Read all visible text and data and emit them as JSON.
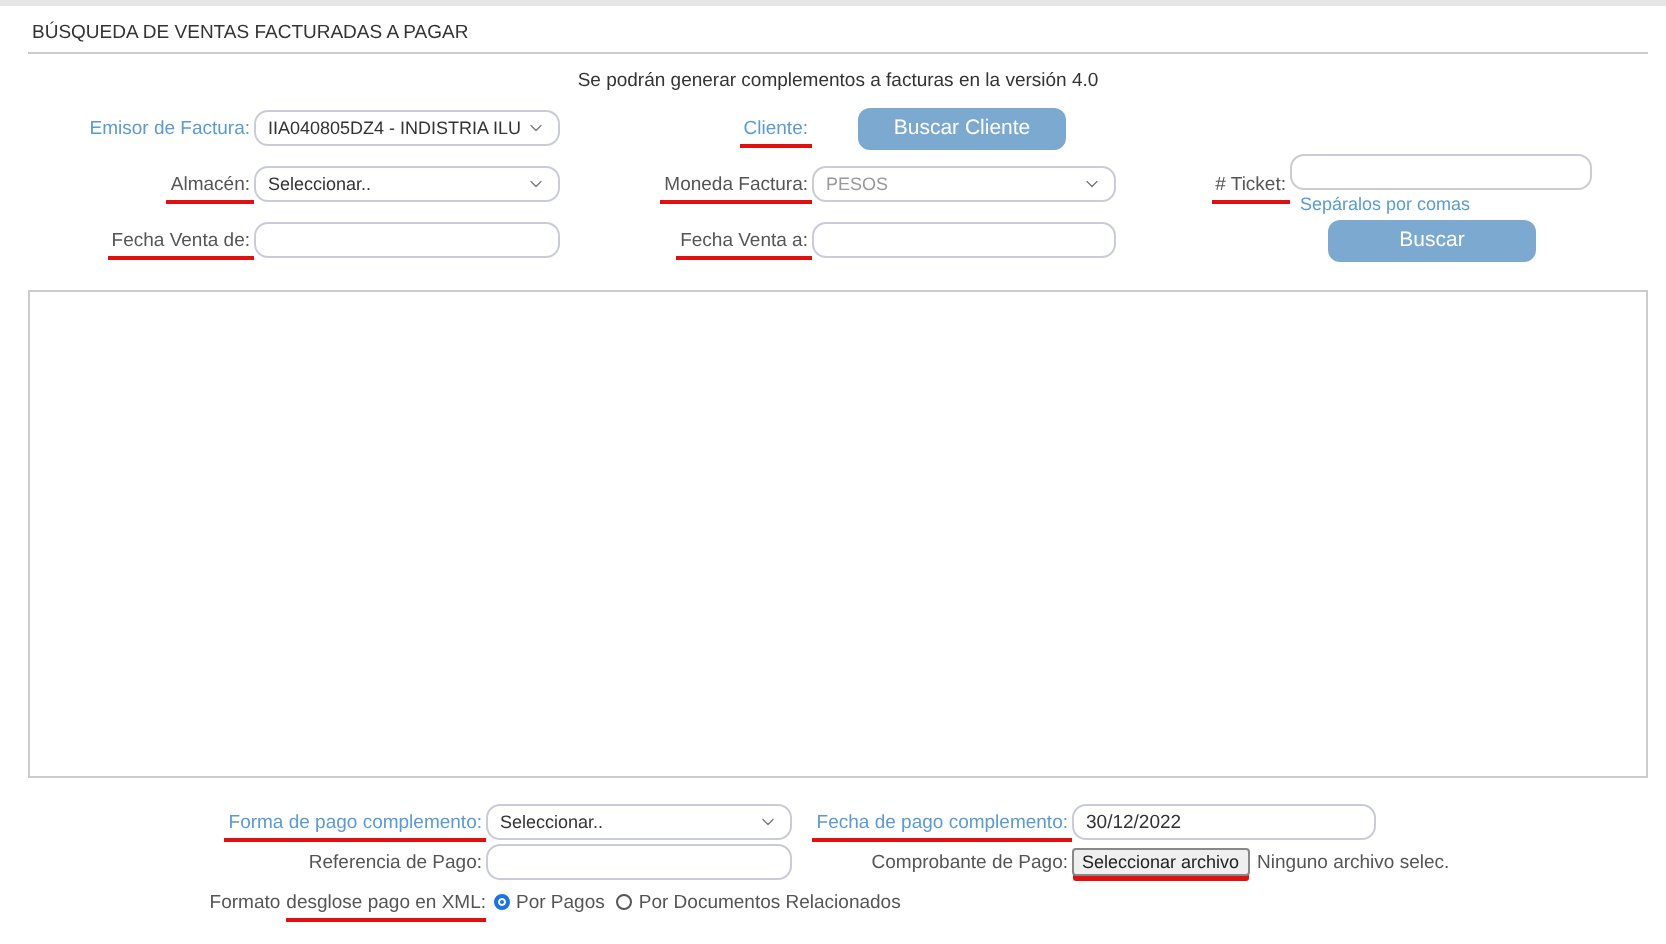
{
  "section_title": "BÚSQUEDA DE VENTAS FACTURADAS A PAGAR",
  "notice": "Se podrán generar complementos a facturas en la versión 4.0",
  "emisor": {
    "label": {
      "text": "Emisor de Factura:",
      "accent": true,
      "marked": false
    },
    "value": "IIA040805DZ4 - INDISTRIA ILU",
    "disabled": false
  },
  "cliente": {
    "label": {
      "text": "Cliente:",
      "accent": true,
      "marked": true
    },
    "button": "Buscar Cliente"
  },
  "almacen": {
    "label": {
      "text": "Almacén:",
      "accent": false,
      "marked": true
    },
    "value": "Seleccionar..",
    "disabled": false
  },
  "moneda": {
    "label": {
      "text": "Moneda Factura:",
      "accent": false,
      "marked": true
    },
    "value": "PESOS",
    "disabled": true
  },
  "ticket": {
    "label": {
      "text": "# Ticket:",
      "accent": false,
      "marked": true
    },
    "hint": "Sepáralos por comas"
  },
  "fecha_de": {
    "label": {
      "text": "Fecha Venta de:",
      "accent": false,
      "marked": true
    }
  },
  "fecha_a": {
    "label": {
      "text": "Fecha Venta a:",
      "accent": false,
      "marked": true
    }
  },
  "search_button": "Buscar",
  "forma_pago": {
    "label": {
      "text": "Forma de pago complemento:",
      "accent": true,
      "marked": true
    },
    "value": "Seleccionar..",
    "disabled": false
  },
  "fecha_pago": {
    "label": {
      "text": "Fecha de pago complemento:",
      "accent": true,
      "marked": true
    },
    "value": "30/12/2022"
  },
  "referencia": {
    "label": {
      "text": "Referencia de Pago:",
      "accent": false,
      "marked": false
    }
  },
  "comprobante": {
    "label": {
      "text": "Comprobante de Pago:",
      "accent": false,
      "marked": false
    },
    "button": "Seleccionar archivo",
    "button_marked": true,
    "status": "Ninguno archivo selec."
  },
  "formato": {
    "label_parts": [
      {
        "text": "Formato",
        "marked": false
      },
      {
        "text": "desglose pago en XML:",
        "marked": true
      }
    ],
    "options": [
      {
        "label": "Por Pagos",
        "selected": true
      },
      {
        "label": "Por Documentos Relacionados",
        "selected": false
      }
    ]
  }
}
